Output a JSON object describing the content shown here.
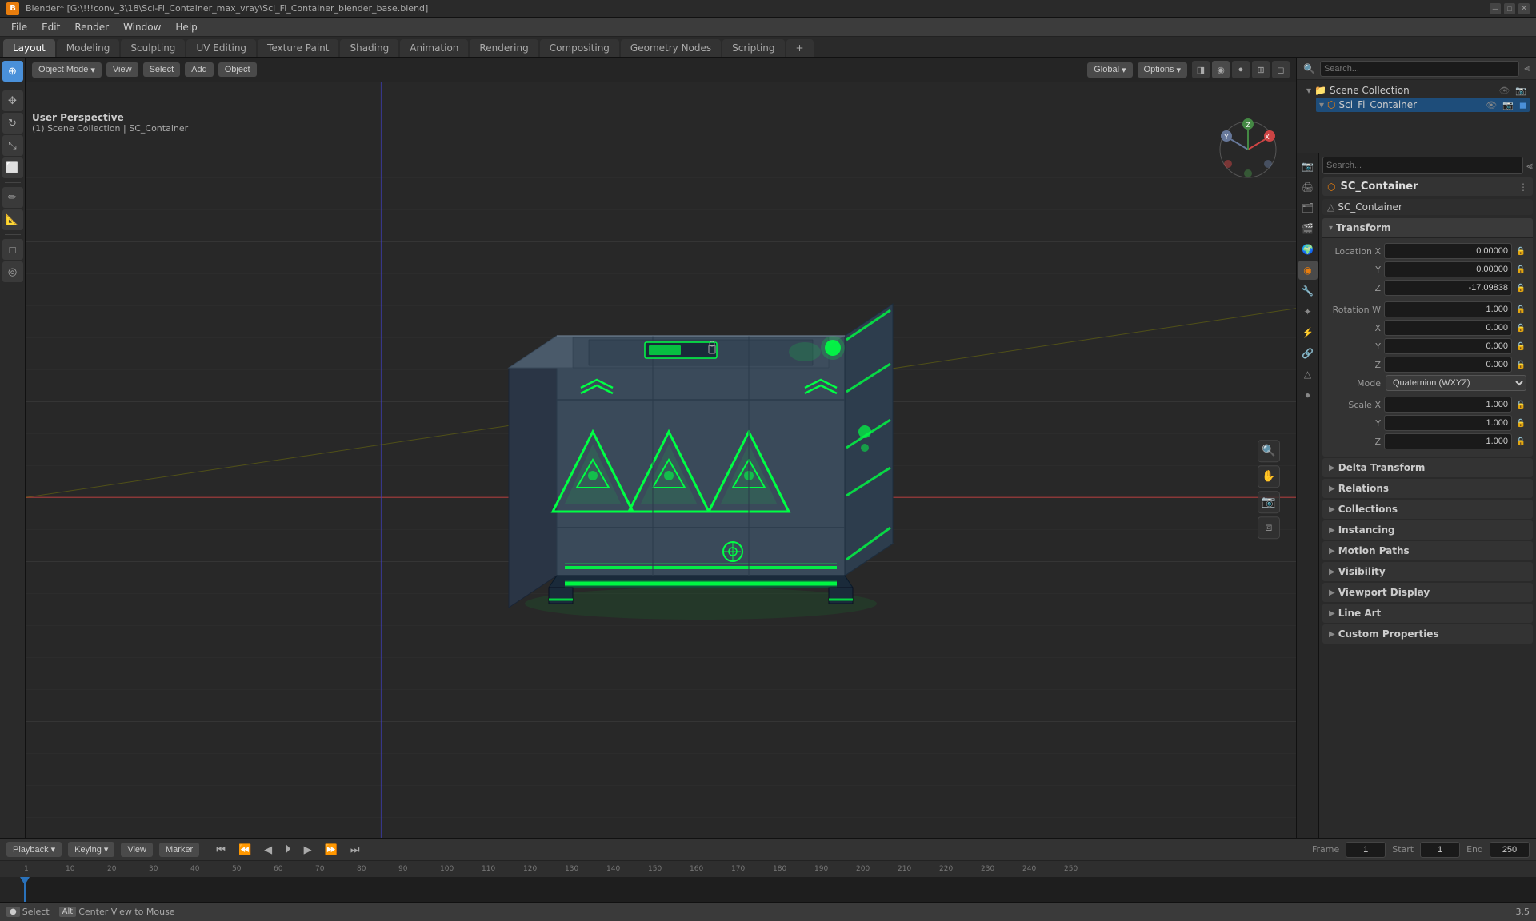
{
  "titlebar": {
    "title": "Blender* [G:\\!!!conv_3\\18\\Sci-Fi_Container_max_vray\\Sci_Fi_Container_blender_base.blend]",
    "icon": "B"
  },
  "menubar": {
    "items": [
      "File",
      "Edit",
      "Render",
      "Window",
      "Help"
    ]
  },
  "workspace_tabs": {
    "tabs": [
      "Layout",
      "Modeling",
      "Sculpting",
      "UV Editing",
      "Texture Paint",
      "Shading",
      "Animation",
      "Rendering",
      "Compositing",
      "Geometry Nodes",
      "Scripting",
      "+"
    ],
    "active": "Layout"
  },
  "viewport": {
    "mode_label": "Object Mode",
    "mode": "Object Mode",
    "view_label": "View",
    "select_label": "Select",
    "add_label": "Add",
    "object_label": "Object",
    "options_label": "Options",
    "transform_label": "Global",
    "perspective_label": "User Perspective",
    "collection_path": "(1) Scene Collection | SC_Container"
  },
  "outliner": {
    "search_placeholder": "Search...",
    "title": "Scene Collection",
    "items": [
      {
        "name": "Scene Collection",
        "icon": "📁",
        "level": 0
      },
      {
        "name": "Sci_Fi_Container",
        "icon": "📦",
        "level": 1,
        "selected": true
      }
    ]
  },
  "properties": {
    "active_tab": "object",
    "object_name": "SC_Container",
    "data_name": "SC_Container",
    "transform": {
      "title": "Transform",
      "location_x": "0.00000",
      "location_y": "0.00000",
      "location_z": "-17.09838",
      "rotation_w": "1.000",
      "rotation_x": "0.000",
      "rotation_y": "0.000",
      "rotation_z": "0.000",
      "mode_label": "Mode",
      "mode_value": "Quaternion (WXYZ)",
      "scale_x": "1.000",
      "scale_y": "1.000",
      "scale_z": "1.000"
    },
    "sections": [
      {
        "id": "delta_transform",
        "label": "Delta Transform",
        "collapsed": true
      },
      {
        "id": "relations",
        "label": "Relations",
        "collapsed": true
      },
      {
        "id": "collections",
        "label": "Collections",
        "collapsed": true
      },
      {
        "id": "instancing",
        "label": "Instancing",
        "collapsed": true
      },
      {
        "id": "motion_paths",
        "label": "Motion Paths",
        "collapsed": true
      },
      {
        "id": "visibility",
        "label": "Visibility",
        "collapsed": true
      },
      {
        "id": "viewport_display",
        "label": "Viewport Display",
        "collapsed": true
      },
      {
        "id": "line_art",
        "label": "Line Art",
        "collapsed": true
      },
      {
        "id": "custom_properties",
        "label": "Custom Properties",
        "collapsed": true
      }
    ]
  },
  "timeline": {
    "playback_label": "Playback",
    "keying_label": "Keying",
    "view_label": "View",
    "marker_label": "Marker",
    "current_frame": "1",
    "start_frame": "1",
    "end_frame": "250",
    "frame_markers": [
      "1",
      "10",
      "20",
      "30",
      "40",
      "50",
      "60",
      "70",
      "80",
      "90",
      "100",
      "110",
      "120",
      "130",
      "140",
      "150",
      "160",
      "170",
      "180",
      "190",
      "200",
      "210",
      "220",
      "230",
      "240",
      "250"
    ]
  },
  "statusbar": {
    "select_label": "Select",
    "mouse_label": "Center View to Mouse",
    "frame_label": "3.5"
  },
  "icons": {
    "arrow_right": "▶",
    "arrow_down": "▼",
    "cursor": "⊕",
    "move": "✥",
    "rotate": "↻",
    "scale": "⤡",
    "transform": "⬛",
    "annotate": "✏",
    "measure": "📏",
    "link": "🔗",
    "eye": "👁",
    "filter": "⫷",
    "scene": "🎬",
    "object": "◉",
    "mesh": "△",
    "material": "●",
    "modifier": "🔧",
    "constraint": "🔗",
    "data": "◆"
  }
}
